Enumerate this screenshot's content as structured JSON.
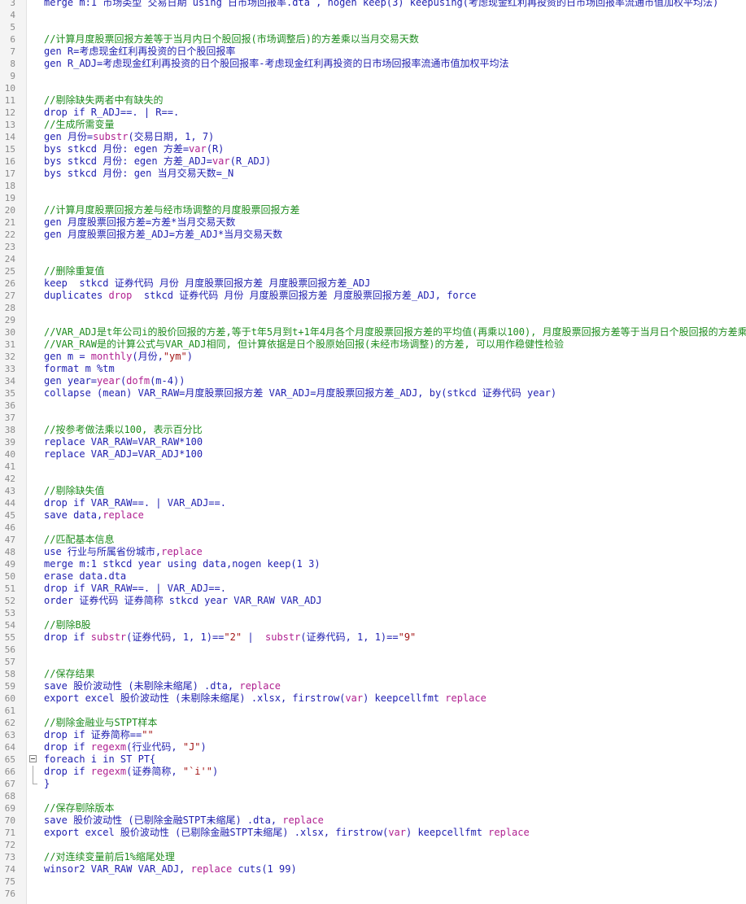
{
  "editor": {
    "colors": {
      "background": "#ffffff",
      "gutter": "#f4f4f4",
      "line_number": "#8a8a8a",
      "code": "#1f1fb0",
      "comment": "#1e8c1e",
      "string": "#a31515",
      "function": "#b02090"
    },
    "lines": [
      {
        "no": "3",
        "fold": "",
        "segs": [
          {
            "c": "n",
            "t": "merge m:1 市场类型 交易日期 using 日市场回报率.dta , nogen keep(3) keepusing(考虑现金红利再投资的日市场回报率流通市值加权平均法)"
          }
        ]
      },
      {
        "no": "4",
        "fold": "",
        "segs": []
      },
      {
        "no": "5",
        "fold": "",
        "segs": []
      },
      {
        "no": "6",
        "fold": "",
        "segs": [
          {
            "c": "cm",
            "t": "//计算月度股票回报方差等于当月内日个股回报(市场调整后)的方差乘以当月交易天数"
          }
        ]
      },
      {
        "no": "7",
        "fold": "",
        "segs": [
          {
            "c": "n",
            "t": "gen R=考虑现金红利再投资的日个股回报率"
          }
        ]
      },
      {
        "no": "8",
        "fold": "",
        "segs": [
          {
            "c": "n",
            "t": "gen R_ADJ=考虑现金红利再投资的日个股回报率-考虑现金红利再投资的日市场回报率流通市值加权平均法"
          }
        ]
      },
      {
        "no": "9",
        "fold": "",
        "segs": []
      },
      {
        "no": "10",
        "fold": "",
        "segs": []
      },
      {
        "no": "11",
        "fold": "",
        "segs": [
          {
            "c": "cm",
            "t": "//剔除缺失两者中有缺失的"
          }
        ]
      },
      {
        "no": "12",
        "fold": "",
        "segs": [
          {
            "c": "n",
            "t": "drop if R_ADJ==. | R==."
          }
        ]
      },
      {
        "no": "13",
        "fold": "",
        "segs": [
          {
            "c": "cm",
            "t": "//生成所需变量"
          }
        ]
      },
      {
        "no": "14",
        "fold": "",
        "segs": [
          {
            "c": "n",
            "t": "gen 月份="
          },
          {
            "c": "fn",
            "t": "substr"
          },
          {
            "c": "n",
            "t": "(交易日期, 1, 7)"
          }
        ]
      },
      {
        "no": "15",
        "fold": "",
        "segs": [
          {
            "c": "n",
            "t": "bys stkcd 月份: egen 方差="
          },
          {
            "c": "fn",
            "t": "var"
          },
          {
            "c": "n",
            "t": "(R)"
          }
        ]
      },
      {
        "no": "16",
        "fold": "",
        "segs": [
          {
            "c": "n",
            "t": "bys stkcd 月份: egen 方差_ADJ="
          },
          {
            "c": "fn",
            "t": "var"
          },
          {
            "c": "n",
            "t": "(R_ADJ)"
          }
        ]
      },
      {
        "no": "17",
        "fold": "",
        "segs": [
          {
            "c": "n",
            "t": "bys stkcd 月份: gen 当月交易天数=_N"
          }
        ]
      },
      {
        "no": "18",
        "fold": "",
        "segs": []
      },
      {
        "no": "19",
        "fold": "",
        "segs": []
      },
      {
        "no": "20",
        "fold": "",
        "segs": [
          {
            "c": "cm",
            "t": "//计算月度股票回报方差与经市场调整的月度股票回报方差"
          }
        ]
      },
      {
        "no": "21",
        "fold": "",
        "segs": [
          {
            "c": "n",
            "t": "gen 月度股票回报方差=方差*当月交易天数"
          }
        ]
      },
      {
        "no": "22",
        "fold": "",
        "segs": [
          {
            "c": "n",
            "t": "gen 月度股票回报方差_ADJ=方差_ADJ*当月交易天数"
          }
        ]
      },
      {
        "no": "23",
        "fold": "",
        "segs": []
      },
      {
        "no": "24",
        "fold": "",
        "segs": []
      },
      {
        "no": "25",
        "fold": "",
        "segs": [
          {
            "c": "cm",
            "t": "//删除重复值"
          }
        ]
      },
      {
        "no": "26",
        "fold": "",
        "segs": [
          {
            "c": "n",
            "t": "keep  stkcd 证券代码 月份 月度股票回报方差 月度股票回报方差_ADJ"
          }
        ]
      },
      {
        "no": "27",
        "fold": "",
        "segs": [
          {
            "c": "n",
            "t": "duplicates "
          },
          {
            "c": "fn",
            "t": "drop"
          },
          {
            "c": "n",
            "t": "  stkcd 证券代码 月份 月度股票回报方差 月度股票回报方差_ADJ, force"
          }
        ]
      },
      {
        "no": "28",
        "fold": "",
        "segs": []
      },
      {
        "no": "29",
        "fold": "",
        "segs": []
      },
      {
        "no": "30",
        "fold": "",
        "segs": [
          {
            "c": "cm",
            "t": "//VAR_ADJ是t年公司i的股价回报的方差,等于t年5月到t+1年4月各个月度股票回报方差的平均值(再乘以100), 月度股票回报方差等于当月日个股回报的方差乘以当月交易天数"
          }
        ]
      },
      {
        "no": "31",
        "fold": "",
        "segs": [
          {
            "c": "cm",
            "t": "//VAR_RAW是的计算公式与VAR_ADJ相同, 但计算依据是日个股原始回报(未经市场调整)的方差, 可以用作稳健性检验"
          }
        ]
      },
      {
        "no": "32",
        "fold": "",
        "segs": [
          {
            "c": "n",
            "t": "gen m = "
          },
          {
            "c": "fn",
            "t": "monthly"
          },
          {
            "c": "n",
            "t": "(月份,"
          },
          {
            "c": "str",
            "t": "\"ym\""
          },
          {
            "c": "n",
            "t": ")"
          }
        ]
      },
      {
        "no": "33",
        "fold": "",
        "segs": [
          {
            "c": "n",
            "t": "format m %tm"
          }
        ]
      },
      {
        "no": "34",
        "fold": "",
        "segs": [
          {
            "c": "n",
            "t": "gen year="
          },
          {
            "c": "fn",
            "t": "year"
          },
          {
            "c": "n",
            "t": "("
          },
          {
            "c": "fn",
            "t": "dofm"
          },
          {
            "c": "n",
            "t": "(m-4))"
          }
        ]
      },
      {
        "no": "35",
        "fold": "",
        "segs": [
          {
            "c": "n",
            "t": "collapse (mean) VAR_RAW=月度股票回报方差 VAR_ADJ=月度股票回报方差_ADJ, by(stkcd 证券代码 year)"
          }
        ]
      },
      {
        "no": "36",
        "fold": "",
        "segs": []
      },
      {
        "no": "37",
        "fold": "",
        "segs": []
      },
      {
        "no": "38",
        "fold": "",
        "segs": [
          {
            "c": "cm",
            "t": "//按参考做法乘以100, 表示百分比"
          }
        ]
      },
      {
        "no": "39",
        "fold": "",
        "segs": [
          {
            "c": "n",
            "t": "replace VAR_RAW=VAR_RAW*100"
          }
        ]
      },
      {
        "no": "40",
        "fold": "",
        "segs": [
          {
            "c": "n",
            "t": "replace VAR_ADJ=VAR_ADJ*100"
          }
        ]
      },
      {
        "no": "41",
        "fold": "",
        "segs": []
      },
      {
        "no": "42",
        "fold": "",
        "segs": []
      },
      {
        "no": "43",
        "fold": "",
        "segs": [
          {
            "c": "cm",
            "t": "//剔除缺失值"
          }
        ]
      },
      {
        "no": "44",
        "fold": "",
        "segs": [
          {
            "c": "n",
            "t": "drop if VAR_RAW==. | VAR_ADJ==."
          }
        ]
      },
      {
        "no": "45",
        "fold": "",
        "segs": [
          {
            "c": "n",
            "t": "save data,"
          },
          {
            "c": "fn",
            "t": "replace"
          }
        ]
      },
      {
        "no": "46",
        "fold": "",
        "segs": []
      },
      {
        "no": "47",
        "fold": "",
        "segs": [
          {
            "c": "cm",
            "t": "//匹配基本信息"
          }
        ]
      },
      {
        "no": "48",
        "fold": "",
        "segs": [
          {
            "c": "n",
            "t": "use 行业与所属省份城市,"
          },
          {
            "c": "fn",
            "t": "replace"
          }
        ]
      },
      {
        "no": "49",
        "fold": "",
        "segs": [
          {
            "c": "n",
            "t": "merge m:1 stkcd year using data,nogen keep(1 3)"
          }
        ]
      },
      {
        "no": "50",
        "fold": "",
        "segs": [
          {
            "c": "n",
            "t": "erase data.dta"
          }
        ]
      },
      {
        "no": "51",
        "fold": "",
        "segs": [
          {
            "c": "n",
            "t": "drop if VAR_RAW==. | VAR_ADJ==."
          }
        ]
      },
      {
        "no": "52",
        "fold": "",
        "segs": [
          {
            "c": "n",
            "t": "order 证券代码 证券简称 stkcd year VAR_RAW VAR_ADJ"
          }
        ]
      },
      {
        "no": "53",
        "fold": "",
        "segs": []
      },
      {
        "no": "54",
        "fold": "",
        "segs": [
          {
            "c": "cm",
            "t": "//剔除B股"
          }
        ]
      },
      {
        "no": "55",
        "fold": "",
        "segs": [
          {
            "c": "n",
            "t": "drop if "
          },
          {
            "c": "fn",
            "t": "substr"
          },
          {
            "c": "n",
            "t": "(证券代码, 1, 1)=="
          },
          {
            "c": "str",
            "t": "\"2\""
          },
          {
            "c": "n",
            "t": " |  "
          },
          {
            "c": "fn",
            "t": "substr"
          },
          {
            "c": "n",
            "t": "(证券代码, 1, 1)=="
          },
          {
            "c": "str",
            "t": "\"9\""
          }
        ]
      },
      {
        "no": "56",
        "fold": "",
        "segs": []
      },
      {
        "no": "57",
        "fold": "",
        "segs": []
      },
      {
        "no": "58",
        "fold": "",
        "segs": [
          {
            "c": "cm",
            "t": "//保存结果"
          }
        ]
      },
      {
        "no": "59",
        "fold": "",
        "segs": [
          {
            "c": "n",
            "t": "save 股价波动性 (未剔除未缩尾) .dta, "
          },
          {
            "c": "fn",
            "t": "replace"
          }
        ]
      },
      {
        "no": "60",
        "fold": "",
        "segs": [
          {
            "c": "n",
            "t": "export excel 股价波动性 (未剔除未缩尾) .xlsx, firstrow("
          },
          {
            "c": "fn",
            "t": "var"
          },
          {
            "c": "n",
            "t": ") keepcellfmt "
          },
          {
            "c": "fn",
            "t": "replace"
          }
        ]
      },
      {
        "no": "61",
        "fold": "",
        "segs": []
      },
      {
        "no": "62",
        "fold": "",
        "segs": [
          {
            "c": "cm",
            "t": "//剔除金融业与STPT样本"
          }
        ]
      },
      {
        "no": "63",
        "fold": "",
        "segs": [
          {
            "c": "n",
            "t": "drop if 证券简称=="
          },
          {
            "c": "str",
            "t": "\"\""
          }
        ]
      },
      {
        "no": "64",
        "fold": "",
        "segs": [
          {
            "c": "n",
            "t": "drop if "
          },
          {
            "c": "fn",
            "t": "regexm"
          },
          {
            "c": "n",
            "t": "(行业代码, "
          },
          {
            "c": "str",
            "t": "\"J\""
          },
          {
            "c": "n",
            "t": ")"
          }
        ]
      },
      {
        "no": "65",
        "fold": "open",
        "segs": [
          {
            "c": "n",
            "t": "foreach i in ST PT{"
          }
        ]
      },
      {
        "no": "66",
        "fold": "mid",
        "segs": [
          {
            "c": "n",
            "t": "drop if "
          },
          {
            "c": "fn",
            "t": "regexm"
          },
          {
            "c": "n",
            "t": "(证券简称, "
          },
          {
            "c": "str",
            "t": "\"`i'\""
          },
          {
            "c": "n",
            "t": ")"
          }
        ]
      },
      {
        "no": "67",
        "fold": "end",
        "segs": [
          {
            "c": "n",
            "t": "}"
          }
        ]
      },
      {
        "no": "68",
        "fold": "",
        "segs": []
      },
      {
        "no": "69",
        "fold": "",
        "segs": [
          {
            "c": "cm",
            "t": "//保存剔除版本"
          }
        ]
      },
      {
        "no": "70",
        "fold": "",
        "segs": [
          {
            "c": "n",
            "t": "save 股价波动性 (已剔除金融STPT未缩尾) .dta, "
          },
          {
            "c": "fn",
            "t": "replace"
          }
        ]
      },
      {
        "no": "71",
        "fold": "",
        "segs": [
          {
            "c": "n",
            "t": "export excel 股价波动性 (已剔除金融STPT未缩尾) .xlsx, firstrow("
          },
          {
            "c": "fn",
            "t": "var"
          },
          {
            "c": "n",
            "t": ") keepcellfmt "
          },
          {
            "c": "fn",
            "t": "replace"
          }
        ]
      },
      {
        "no": "72",
        "fold": "",
        "segs": []
      },
      {
        "no": "73",
        "fold": "",
        "segs": [
          {
            "c": "cm",
            "t": "//对连续变量前后1%缩尾处理"
          }
        ]
      },
      {
        "no": "74",
        "fold": "",
        "segs": [
          {
            "c": "n",
            "t": "winsor2 VAR_RAW VAR_ADJ, "
          },
          {
            "c": "fn",
            "t": "replace"
          },
          {
            "c": "n",
            "t": " cuts(1 99)"
          }
        ]
      },
      {
        "no": "75",
        "fold": "",
        "segs": []
      },
      {
        "no": "76",
        "fold": "",
        "segs": []
      }
    ]
  }
}
